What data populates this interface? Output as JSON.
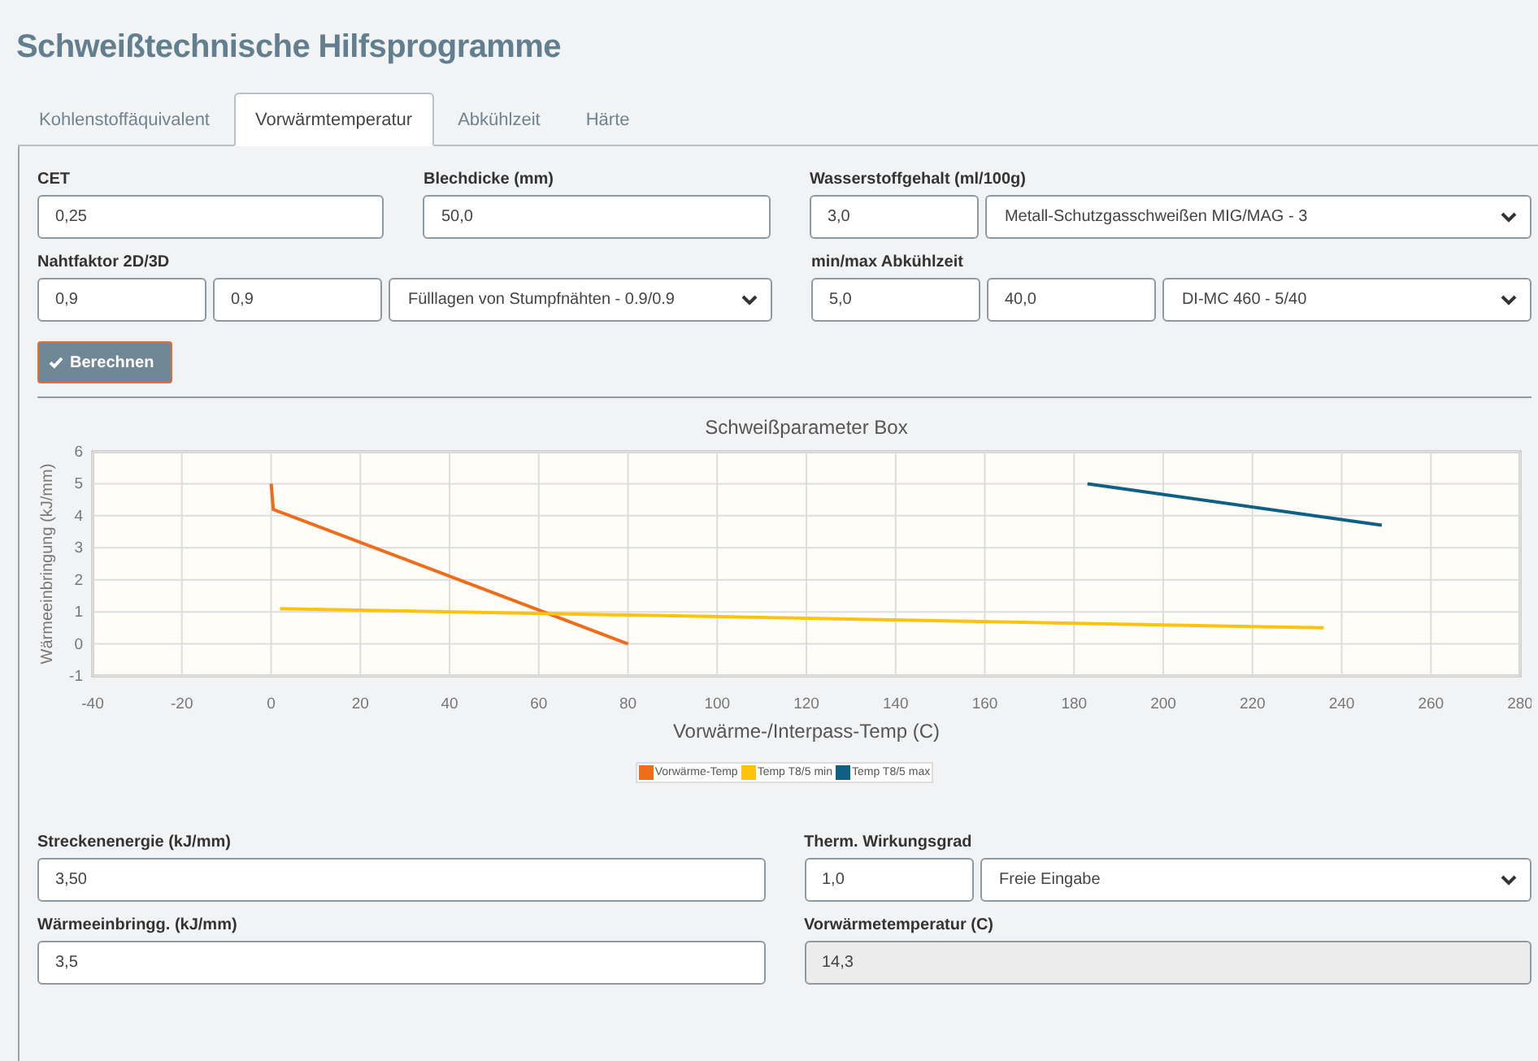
{
  "title": "Schweißtechnische Hilfsprogramme",
  "tabs": [
    {
      "label": "Kohlenstoffäquivalent",
      "selected": false
    },
    {
      "label": "Vorwärmtemperatur",
      "selected": true
    },
    {
      "label": "Abkühlzeit",
      "selected": false
    },
    {
      "label": "Härte",
      "selected": false
    }
  ],
  "input_rows": [
    [
      {
        "label": "CET",
        "controls": [
          {
            "kind": "input",
            "value": "0,25",
            "readonly": false
          }
        ]
      },
      {
        "label": "Blechdicke (mm)",
        "controls": [
          {
            "kind": "input",
            "value": "50,0",
            "readonly": false
          }
        ]
      },
      {
        "label": "Wasserstoffgehalt (ml/100g)",
        "controls": [
          {
            "kind": "input",
            "value": "3,0",
            "readonly": false
          },
          {
            "kind": "select",
            "value": "Metall-Schutzgasschweißen MIG/MAG - 3"
          }
        ]
      }
    ],
    [
      {
        "label": "Nahtfaktor 2D/3D",
        "controls": [
          {
            "kind": "input",
            "value": "0,9",
            "readonly": false
          },
          {
            "kind": "input",
            "value": "0,9",
            "readonly": false
          },
          {
            "kind": "select",
            "value": "Fülllagen von Stumpfnähten - 0.9/0.9"
          }
        ]
      },
      {
        "label": "min/max Abkühlzeit",
        "controls": [
          {
            "kind": "input",
            "value": "5,0",
            "readonly": false
          },
          {
            "kind": "input",
            "value": "40,0",
            "readonly": false
          },
          {
            "kind": "select",
            "value": "DI-MC 460 - 5/40"
          }
        ]
      }
    ]
  ],
  "calculate_button": {
    "label": "Berechnen"
  },
  "chart_data": {
    "type": "line",
    "title": "Schweißparameter Box",
    "xlabel": "Vorwärme-/Interpass-Temp (C)",
    "ylabel": "Wärmeeinbringung (kJ/mm)",
    "xlim": [
      -40,
      280
    ],
    "ylim": [
      -1,
      6
    ],
    "grid": true,
    "legend": true,
    "xticks": [
      -40,
      -20,
      0,
      20,
      40,
      60,
      80,
      100,
      120,
      140,
      160,
      180,
      200,
      220,
      240,
      260,
      280
    ],
    "yticks": [
      -1,
      0,
      1,
      2,
      3,
      4,
      5,
      6
    ],
    "series": [
      {
        "name": "Vorwärme-Temp",
        "color": "#ef6c1a",
        "x": [
          0,
          0.5,
          80
        ],
        "values": [
          5,
          4.2,
          0
        ]
      },
      {
        "name": "Temp T8/5 min",
        "color": "#ffc20e",
        "x": [
          2,
          236
        ],
        "values": [
          1.1,
          0.5
        ]
      },
      {
        "name": "Temp T8/5 max",
        "color": "#0e6185",
        "x": [
          183,
          249
        ],
        "values": [
          5,
          3.7
        ]
      }
    ]
  },
  "result_rows": [
    [
      {
        "label": "Streckenenergie (kJ/mm)",
        "controls": [
          {
            "kind": "input",
            "value": "3,50",
            "readonly": false
          }
        ]
      },
      {
        "label": "Therm. Wirkungsgrad",
        "controls": [
          {
            "kind": "input",
            "value": "1,0",
            "readonly": false
          },
          {
            "kind": "select",
            "value": "Freie Eingabe"
          }
        ]
      }
    ],
    [
      {
        "label": "Wärmeeinbringg. (kJ/mm)",
        "controls": [
          {
            "kind": "input",
            "value": "3,5",
            "readonly": false
          }
        ]
      },
      {
        "label": "Vorwärmetemperatur (C)",
        "controls": [
          {
            "kind": "input",
            "value": "14,3",
            "readonly": true
          }
        ]
      }
    ]
  ]
}
